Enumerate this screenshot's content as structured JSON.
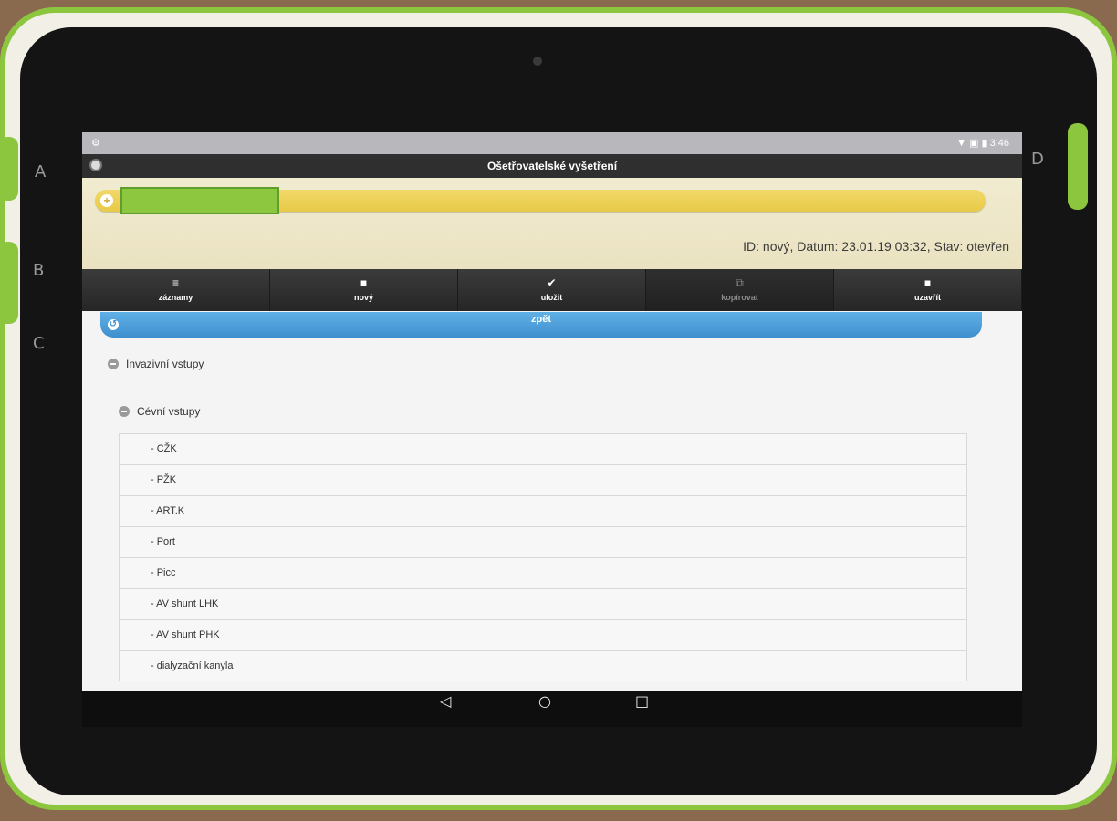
{
  "device": {
    "left_keys": [
      "A",
      "B",
      "C"
    ],
    "right_key": "D"
  },
  "status_bar": {
    "notification_icon": "⚙",
    "right_text": "▼ ▣ ▮ 3:46"
  },
  "app_bar": {
    "title": "Ošetřovatelské vyšetření",
    "menu_icon": "●"
  },
  "patient": {
    "add_icon": "+",
    "record_meta": "ID: nový, Datum: 23.01.19 03:32, Stav: otevřen"
  },
  "toolbar": {
    "buttons": [
      {
        "label": "záznamy",
        "icon": "≡",
        "enabled": true
      },
      {
        "label": "nový",
        "icon": "■",
        "enabled": true
      },
      {
        "label": "uložit",
        "icon": "✔",
        "enabled": true
      },
      {
        "label": "kopírovat",
        "icon": "⧉",
        "enabled": false
      },
      {
        "label": "uzavřít",
        "icon": "■",
        "enabled": true
      }
    ]
  },
  "back": {
    "label": "zpět",
    "icon": "↺"
  },
  "sections": {
    "invasive": "Invazivní vstupy",
    "vascular": "Cévní vstupy"
  },
  "items": [
    "- CŽK",
    "- PŽK",
    "- ART.K",
    "- Port",
    "- Picc",
    "- AV shunt LHK",
    "- AV shunt PHK",
    "- dialyzační kanyla"
  ],
  "nav": {
    "back_icon": "◁",
    "home_icon": "○",
    "recents_icon": "□"
  }
}
